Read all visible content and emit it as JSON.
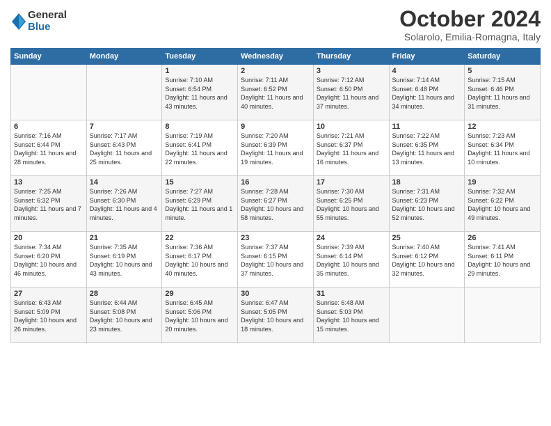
{
  "logo": {
    "general": "General",
    "blue": "Blue"
  },
  "title": "October 2024",
  "subtitle": "Solarolo, Emilia-Romagna, Italy",
  "headers": [
    "Sunday",
    "Monday",
    "Tuesday",
    "Wednesday",
    "Thursday",
    "Friday",
    "Saturday"
  ],
  "weeks": [
    [
      {
        "day": "",
        "info": ""
      },
      {
        "day": "",
        "info": ""
      },
      {
        "day": "1",
        "info": "Sunrise: 7:10 AM\nSunset: 6:54 PM\nDaylight: 11 hours and 43 minutes."
      },
      {
        "day": "2",
        "info": "Sunrise: 7:11 AM\nSunset: 6:52 PM\nDaylight: 11 hours and 40 minutes."
      },
      {
        "day": "3",
        "info": "Sunrise: 7:12 AM\nSunset: 6:50 PM\nDaylight: 11 hours and 37 minutes."
      },
      {
        "day": "4",
        "info": "Sunrise: 7:14 AM\nSunset: 6:48 PM\nDaylight: 11 hours and 34 minutes."
      },
      {
        "day": "5",
        "info": "Sunrise: 7:15 AM\nSunset: 6:46 PM\nDaylight: 11 hours and 31 minutes."
      }
    ],
    [
      {
        "day": "6",
        "info": "Sunrise: 7:16 AM\nSunset: 6:44 PM\nDaylight: 11 hours and 28 minutes."
      },
      {
        "day": "7",
        "info": "Sunrise: 7:17 AM\nSunset: 6:43 PM\nDaylight: 11 hours and 25 minutes."
      },
      {
        "day": "8",
        "info": "Sunrise: 7:19 AM\nSunset: 6:41 PM\nDaylight: 11 hours and 22 minutes."
      },
      {
        "day": "9",
        "info": "Sunrise: 7:20 AM\nSunset: 6:39 PM\nDaylight: 11 hours and 19 minutes."
      },
      {
        "day": "10",
        "info": "Sunrise: 7:21 AM\nSunset: 6:37 PM\nDaylight: 11 hours and 16 minutes."
      },
      {
        "day": "11",
        "info": "Sunrise: 7:22 AM\nSunset: 6:35 PM\nDaylight: 11 hours and 13 minutes."
      },
      {
        "day": "12",
        "info": "Sunrise: 7:23 AM\nSunset: 6:34 PM\nDaylight: 11 hours and 10 minutes."
      }
    ],
    [
      {
        "day": "13",
        "info": "Sunrise: 7:25 AM\nSunset: 6:32 PM\nDaylight: 11 hours and 7 minutes."
      },
      {
        "day": "14",
        "info": "Sunrise: 7:26 AM\nSunset: 6:30 PM\nDaylight: 11 hours and 4 minutes."
      },
      {
        "day": "15",
        "info": "Sunrise: 7:27 AM\nSunset: 6:29 PM\nDaylight: 11 hours and 1 minute."
      },
      {
        "day": "16",
        "info": "Sunrise: 7:28 AM\nSunset: 6:27 PM\nDaylight: 10 hours and 58 minutes."
      },
      {
        "day": "17",
        "info": "Sunrise: 7:30 AM\nSunset: 6:25 PM\nDaylight: 10 hours and 55 minutes."
      },
      {
        "day": "18",
        "info": "Sunrise: 7:31 AM\nSunset: 6:23 PM\nDaylight: 10 hours and 52 minutes."
      },
      {
        "day": "19",
        "info": "Sunrise: 7:32 AM\nSunset: 6:22 PM\nDaylight: 10 hours and 49 minutes."
      }
    ],
    [
      {
        "day": "20",
        "info": "Sunrise: 7:34 AM\nSunset: 6:20 PM\nDaylight: 10 hours and 46 minutes."
      },
      {
        "day": "21",
        "info": "Sunrise: 7:35 AM\nSunset: 6:19 PM\nDaylight: 10 hours and 43 minutes."
      },
      {
        "day": "22",
        "info": "Sunrise: 7:36 AM\nSunset: 6:17 PM\nDaylight: 10 hours and 40 minutes."
      },
      {
        "day": "23",
        "info": "Sunrise: 7:37 AM\nSunset: 6:15 PM\nDaylight: 10 hours and 37 minutes."
      },
      {
        "day": "24",
        "info": "Sunrise: 7:39 AM\nSunset: 6:14 PM\nDaylight: 10 hours and 35 minutes."
      },
      {
        "day": "25",
        "info": "Sunrise: 7:40 AM\nSunset: 6:12 PM\nDaylight: 10 hours and 32 minutes."
      },
      {
        "day": "26",
        "info": "Sunrise: 7:41 AM\nSunset: 6:11 PM\nDaylight: 10 hours and 29 minutes."
      }
    ],
    [
      {
        "day": "27",
        "info": "Sunrise: 6:43 AM\nSunset: 5:09 PM\nDaylight: 10 hours and 26 minutes."
      },
      {
        "day": "28",
        "info": "Sunrise: 6:44 AM\nSunset: 5:08 PM\nDaylight: 10 hours and 23 minutes."
      },
      {
        "day": "29",
        "info": "Sunrise: 6:45 AM\nSunset: 5:06 PM\nDaylight: 10 hours and 20 minutes."
      },
      {
        "day": "30",
        "info": "Sunrise: 6:47 AM\nSunset: 5:05 PM\nDaylight: 10 hours and 18 minutes."
      },
      {
        "day": "31",
        "info": "Sunrise: 6:48 AM\nSunset: 5:03 PM\nDaylight: 10 hours and 15 minutes."
      },
      {
        "day": "",
        "info": ""
      },
      {
        "day": "",
        "info": ""
      }
    ]
  ]
}
